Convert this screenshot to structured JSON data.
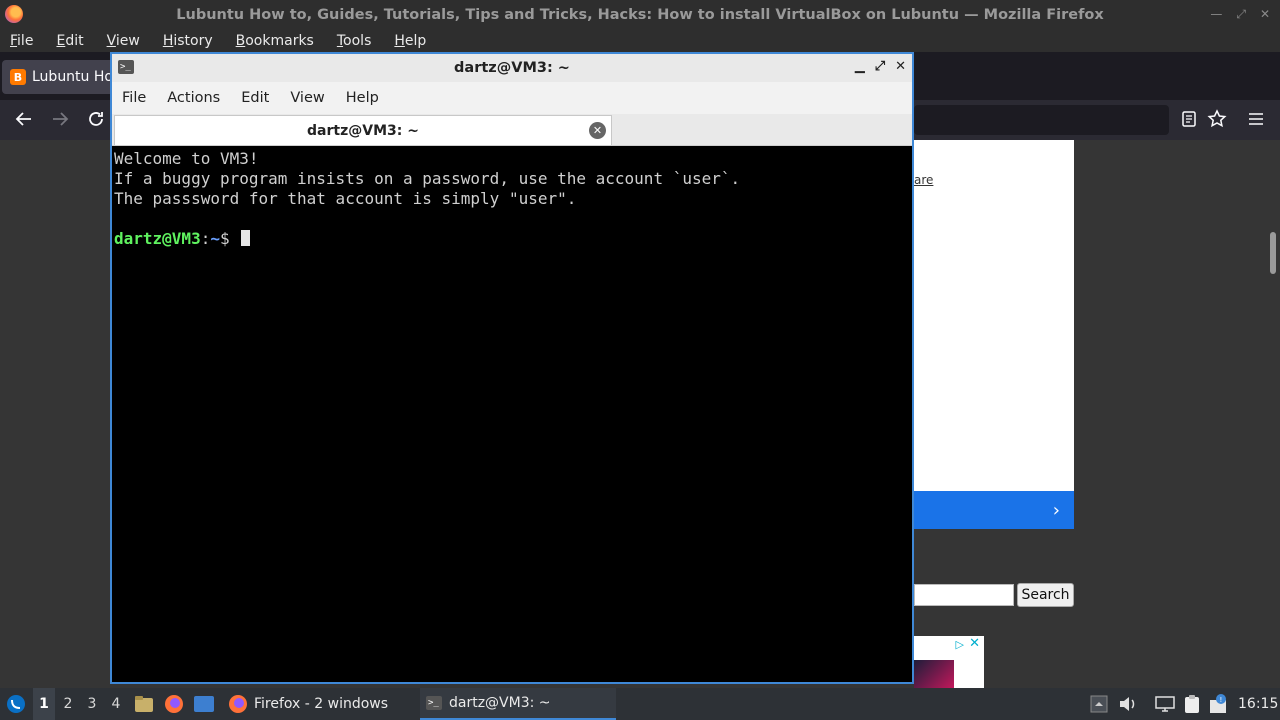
{
  "firefox": {
    "window_title": "Lubuntu How to, Guides, Tutorials, Tips and Tricks, Hacks: How to install VirtualBox on Lubuntu — Mozilla Firefox",
    "menu": [
      "File",
      "Edit",
      "View",
      "History",
      "Bookmarks",
      "Tools",
      "Help"
    ],
    "tab_title": "Lubuntu How to, Guides, Tutorials, Tips and Tricks, Hacks: How to install VirtualBox on Lubuntu",
    "tab_title_visible": "Lubuntu Ho",
    "nav_icons": [
      "back-icon",
      "forward-icon",
      "reload-icon",
      "reader-view-icon",
      "bookmark-star-icon",
      "hamburger-menu-icon"
    ]
  },
  "webpage": {
    "fragment_text": "are",
    "search_button": "Search",
    "ad_choice": "▷",
    "ad_close": "✕",
    "blue_bar_arrow": "›"
  },
  "terminal": {
    "title": "dartz@VM3: ~",
    "menu": [
      "File",
      "Actions",
      "Edit",
      "View",
      "Help"
    ],
    "tab_title": "dartz@VM3: ~",
    "lines": [
      "Welcome to VM3!",
      "If a buggy program insists on a password, use the account `user`.",
      "The passsword for that account is simply \"user\"."
    ],
    "prompt": {
      "user_host": "dartz@VM3",
      "sep": ":",
      "path": "~",
      "symbol": "$"
    }
  },
  "taskbar": {
    "workspaces": [
      "1",
      "2",
      "3",
      "4"
    ],
    "active_workspace": "1",
    "firefox_item": "Firefox - 2 windows",
    "terminal_item": "dartz@VM3: ~",
    "clock": "16:15",
    "icons": [
      "lubuntu-menu-icon",
      "file-manager-icon",
      "firefox-icon",
      "show-desktop-icon",
      "volume-icon",
      "network-icon",
      "clipboard-icon",
      "update-notifier-icon"
    ]
  }
}
